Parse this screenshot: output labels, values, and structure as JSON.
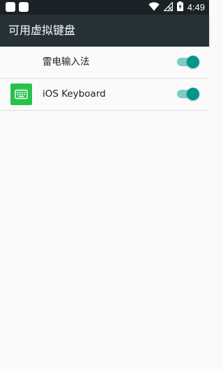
{
  "status_bar": {
    "time": "4:49",
    "icons": [
      "notification-icon",
      "notification-icon",
      "wifi-icon",
      "no-signal-icon",
      "battery-charging-icon"
    ]
  },
  "app_bar": {
    "title": "可用虚拟键盘"
  },
  "keyboards": [
    {
      "label": "雷电输入法",
      "enabled": true,
      "icon": "none"
    },
    {
      "label": "iOS Keyboard",
      "enabled": true,
      "icon": "keyboard-icon"
    }
  ],
  "colors": {
    "status_bar": "#1b2226",
    "app_bar": "#263238",
    "toggle_on_thumb": "#009688",
    "toggle_on_track": "#80cbc4",
    "keyboard_icon_bg": "#27c24c"
  }
}
